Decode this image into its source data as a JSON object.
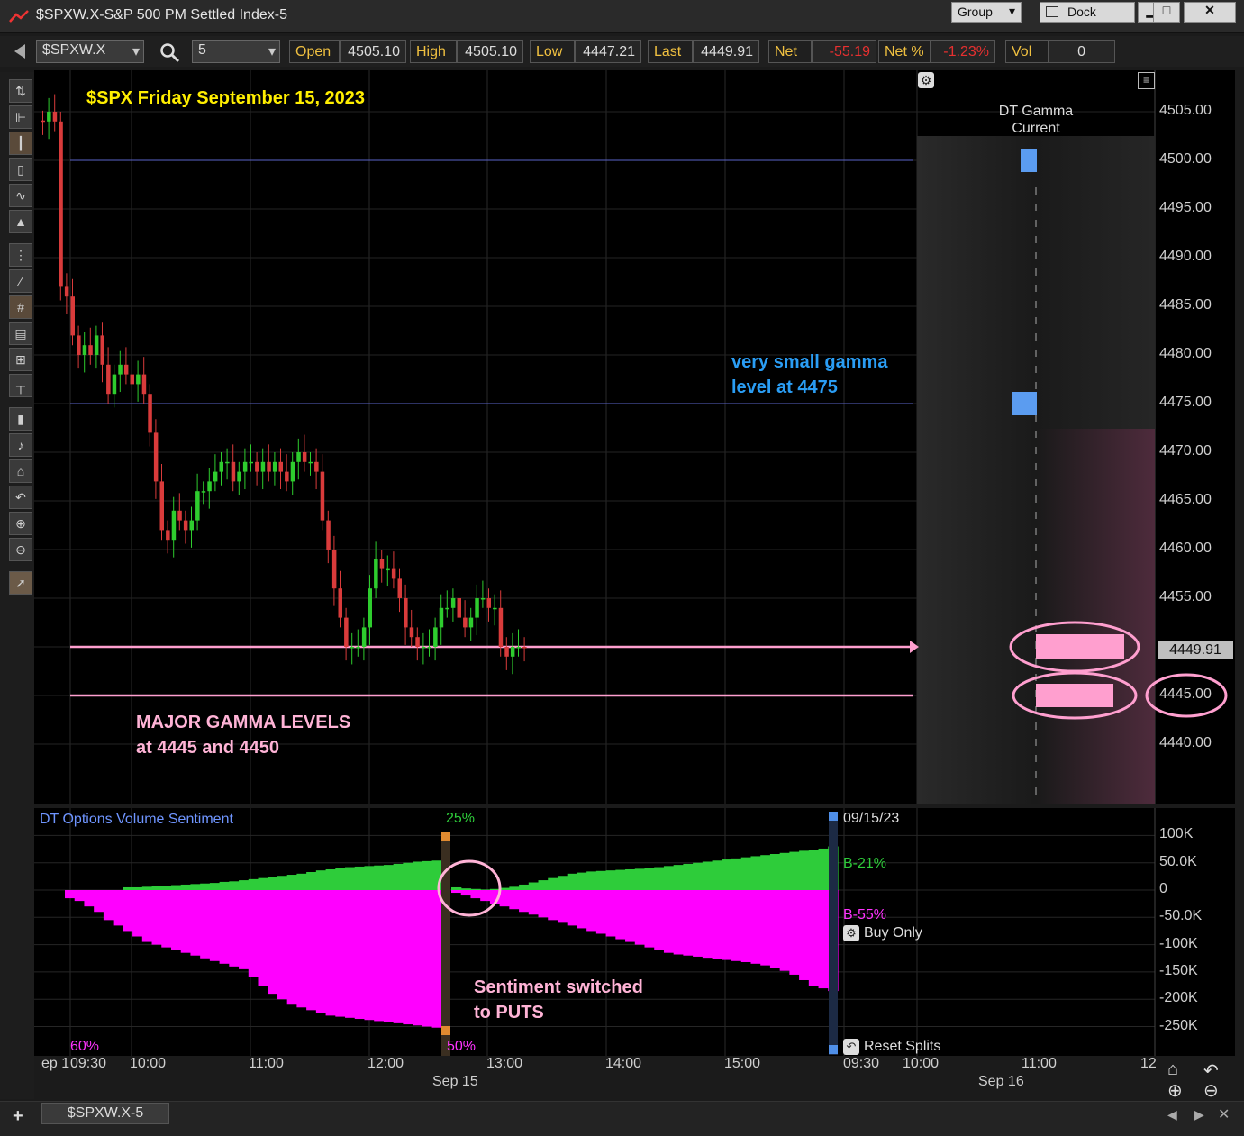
{
  "window": {
    "title": "$SPXW.X-S&P 500 PM Settled Index-5",
    "group_label": "Group",
    "dock_label": "Dock",
    "minimize": "▁",
    "maximize": "□",
    "close": "✕"
  },
  "toolbar": {
    "symbol": "$SPXW.X",
    "interval": "5",
    "open_label": "Open",
    "open_value": "4505.10",
    "high_label": "High",
    "high_value": "4505.10",
    "low_label": "Low",
    "low_value": "4447.21",
    "last_label": "Last",
    "last_value": "4449.91",
    "net_label": "Net",
    "net_value": "-55.19",
    "netpct_label": "Net %",
    "netpct_value": "-1.23%",
    "vol_label": "Vol",
    "vol_value": "0"
  },
  "annotations": {
    "title": "$SPX Friday September 15, 2023",
    "small_gamma_1": "very small gamma",
    "small_gamma_2": "level at 4475",
    "major_gamma_1": "MAJOR GAMMA LEVELS",
    "major_gamma_2": "at 4445 and 4450",
    "sentiment_1": "Sentiment switched",
    "sentiment_2": "to PUTS"
  },
  "gamma_panel": {
    "title_1": "DT Gamma",
    "title_2": "Current"
  },
  "price_axis": {
    "ticks": [
      "4505.00",
      "4500.00",
      "4495.00",
      "4490.00",
      "4485.00",
      "4480.00",
      "4475.00",
      "4470.00",
      "4465.00",
      "4460.00",
      "4455.00",
      "4445.00",
      "4440.00"
    ],
    "last_price": "4449.91"
  },
  "sentiment": {
    "title": "DT Options Volume Sentiment",
    "date": "09/15/23",
    "pct_top": "25%",
    "pct_bottom": "50%",
    "pct_left": "60%",
    "call_label": "B-21%",
    "put_label": "B-55%",
    "buy_only": "Buy Only",
    "reset_splits": "Reset Splits",
    "ticks": [
      "100K",
      "50.0K",
      "0",
      "-50.0K",
      "-100K",
      "-150K",
      "-200K",
      "-250K"
    ]
  },
  "time_axis": {
    "ticks": [
      "ep 1",
      "09:30",
      "10:00",
      "11:00",
      "12:00",
      "13:00",
      "14:00",
      "15:00",
      "09:30",
      "10:00",
      "11:00",
      "12"
    ],
    "dates": [
      "Sep 15",
      "Sep 16"
    ]
  },
  "bottom_tab": {
    "label": "$SPXW.X-5",
    "add": "+"
  },
  "colors": {
    "up": "#2ecc2e",
    "down": "#d93b3b",
    "gamma_major": "#ff9fcf",
    "gamma_minor": "#5b9cf0",
    "call_fill": "#2ecc3a",
    "put_fill": "#ff00ff",
    "title_yellow": "#ffee00",
    "annot_blue": "#2a9df4",
    "annot_pink": "#ffb3d6"
  },
  "chart_data": [
    {
      "type": "candlestick",
      "title": "$SPX Friday September 15, 2023",
      "ylim": [
        4435,
        4508
      ],
      "open": 4505.1,
      "high": 4505.1,
      "low": 4447.21,
      "last": 4449.91,
      "close_path": [
        4504,
        4505,
        4504,
        4487,
        4486,
        4482,
        4480,
        4481,
        4480,
        4482,
        4479,
        4476,
        4478,
        4479,
        4478,
        4477,
        4478,
        4476,
        4472,
        4467,
        4462,
        4461,
        4464,
        4463,
        4462,
        4463,
        4466,
        4466,
        4467,
        4468,
        4469,
        4469,
        4467,
        4468,
        4469,
        4469,
        4468,
        4469,
        4468,
        4469,
        4468,
        4467,
        4469,
        4470,
        4469,
        4469,
        4468,
        4463,
        4460,
        4456,
        4453,
        4450,
        4450,
        4450,
        4452,
        4456,
        4459,
        4458,
        4458,
        4457,
        4455,
        4452,
        4451,
        4450,
        4450,
        4450,
        4452,
        4454,
        4454,
        4455,
        4453,
        4452,
        4453,
        4455,
        4455,
        4454,
        4454,
        4450,
        4449,
        4450,
        4450,
        4449.91
      ],
      "gamma_levels": [
        {
          "price": 4500,
          "size": "small"
        },
        {
          "price": 4475,
          "size": "small"
        },
        {
          "price": 4450,
          "size": "major"
        },
        {
          "price": 4445,
          "size": "major"
        }
      ]
    },
    {
      "type": "area",
      "title": "DT Options Volume Sentiment",
      "ylim": [
        -290000,
        130000
      ],
      "series": [
        {
          "name": "B-21%",
          "values": [
            0,
            0,
            0,
            0,
            0,
            0,
            5000,
            5000,
            6000,
            7000,
            8000,
            9000,
            10000,
            11000,
            12000,
            13000,
            15000,
            16000,
            18000,
            20000,
            22000,
            24000,
            26000,
            28000,
            30000,
            33000,
            36000,
            38000,
            40000,
            42000,
            43000,
            44000,
            45000,
            46000,
            48000,
            50000,
            52000,
            53000,
            54000,
            55000,
            5000,
            3000,
            2000,
            1000,
            2000,
            4000,
            6000,
            10000,
            14000,
            18000,
            22000,
            26000,
            30000,
            32000,
            34000,
            35000,
            36000,
            37000,
            38000,
            39000,
            40000,
            42000,
            44000,
            46000,
            48000,
            50000,
            52000,
            54000,
            56000,
            58000,
            60000,
            62000,
            64000,
            66000,
            68000,
            70000,
            72000,
            74000,
            76000,
            80000
          ]
        },
        {
          "name": "B-55%",
          "values": [
            -15000,
            -20000,
            -30000,
            -40000,
            -55000,
            -65000,
            -75000,
            -85000,
            -95000,
            -100000,
            -105000,
            -110000,
            -115000,
            -120000,
            -125000,
            -130000,
            -135000,
            -140000,
            -145000,
            -160000,
            -175000,
            -190000,
            -200000,
            -210000,
            -215000,
            -220000,
            -225000,
            -230000,
            -232000,
            -234000,
            -236000,
            -238000,
            -240000,
            -242000,
            -244000,
            -246000,
            -248000,
            -250000,
            -252000,
            -255000,
            -5000,
            -10000,
            -15000,
            -20000,
            -25000,
            -30000,
            -35000,
            -40000,
            -45000,
            -50000,
            -55000,
            -60000,
            -65000,
            -70000,
            -75000,
            -80000,
            -85000,
            -90000,
            -95000,
            -100000,
            -105000,
            -110000,
            -115000,
            -118000,
            -120000,
            -122000,
            -124000,
            -126000,
            -128000,
            -130000,
            -132000,
            -135000,
            -138000,
            -142000,
            -148000,
            -155000,
            -165000,
            -175000,
            -180000,
            -185000
          ]
        }
      ]
    }
  ]
}
